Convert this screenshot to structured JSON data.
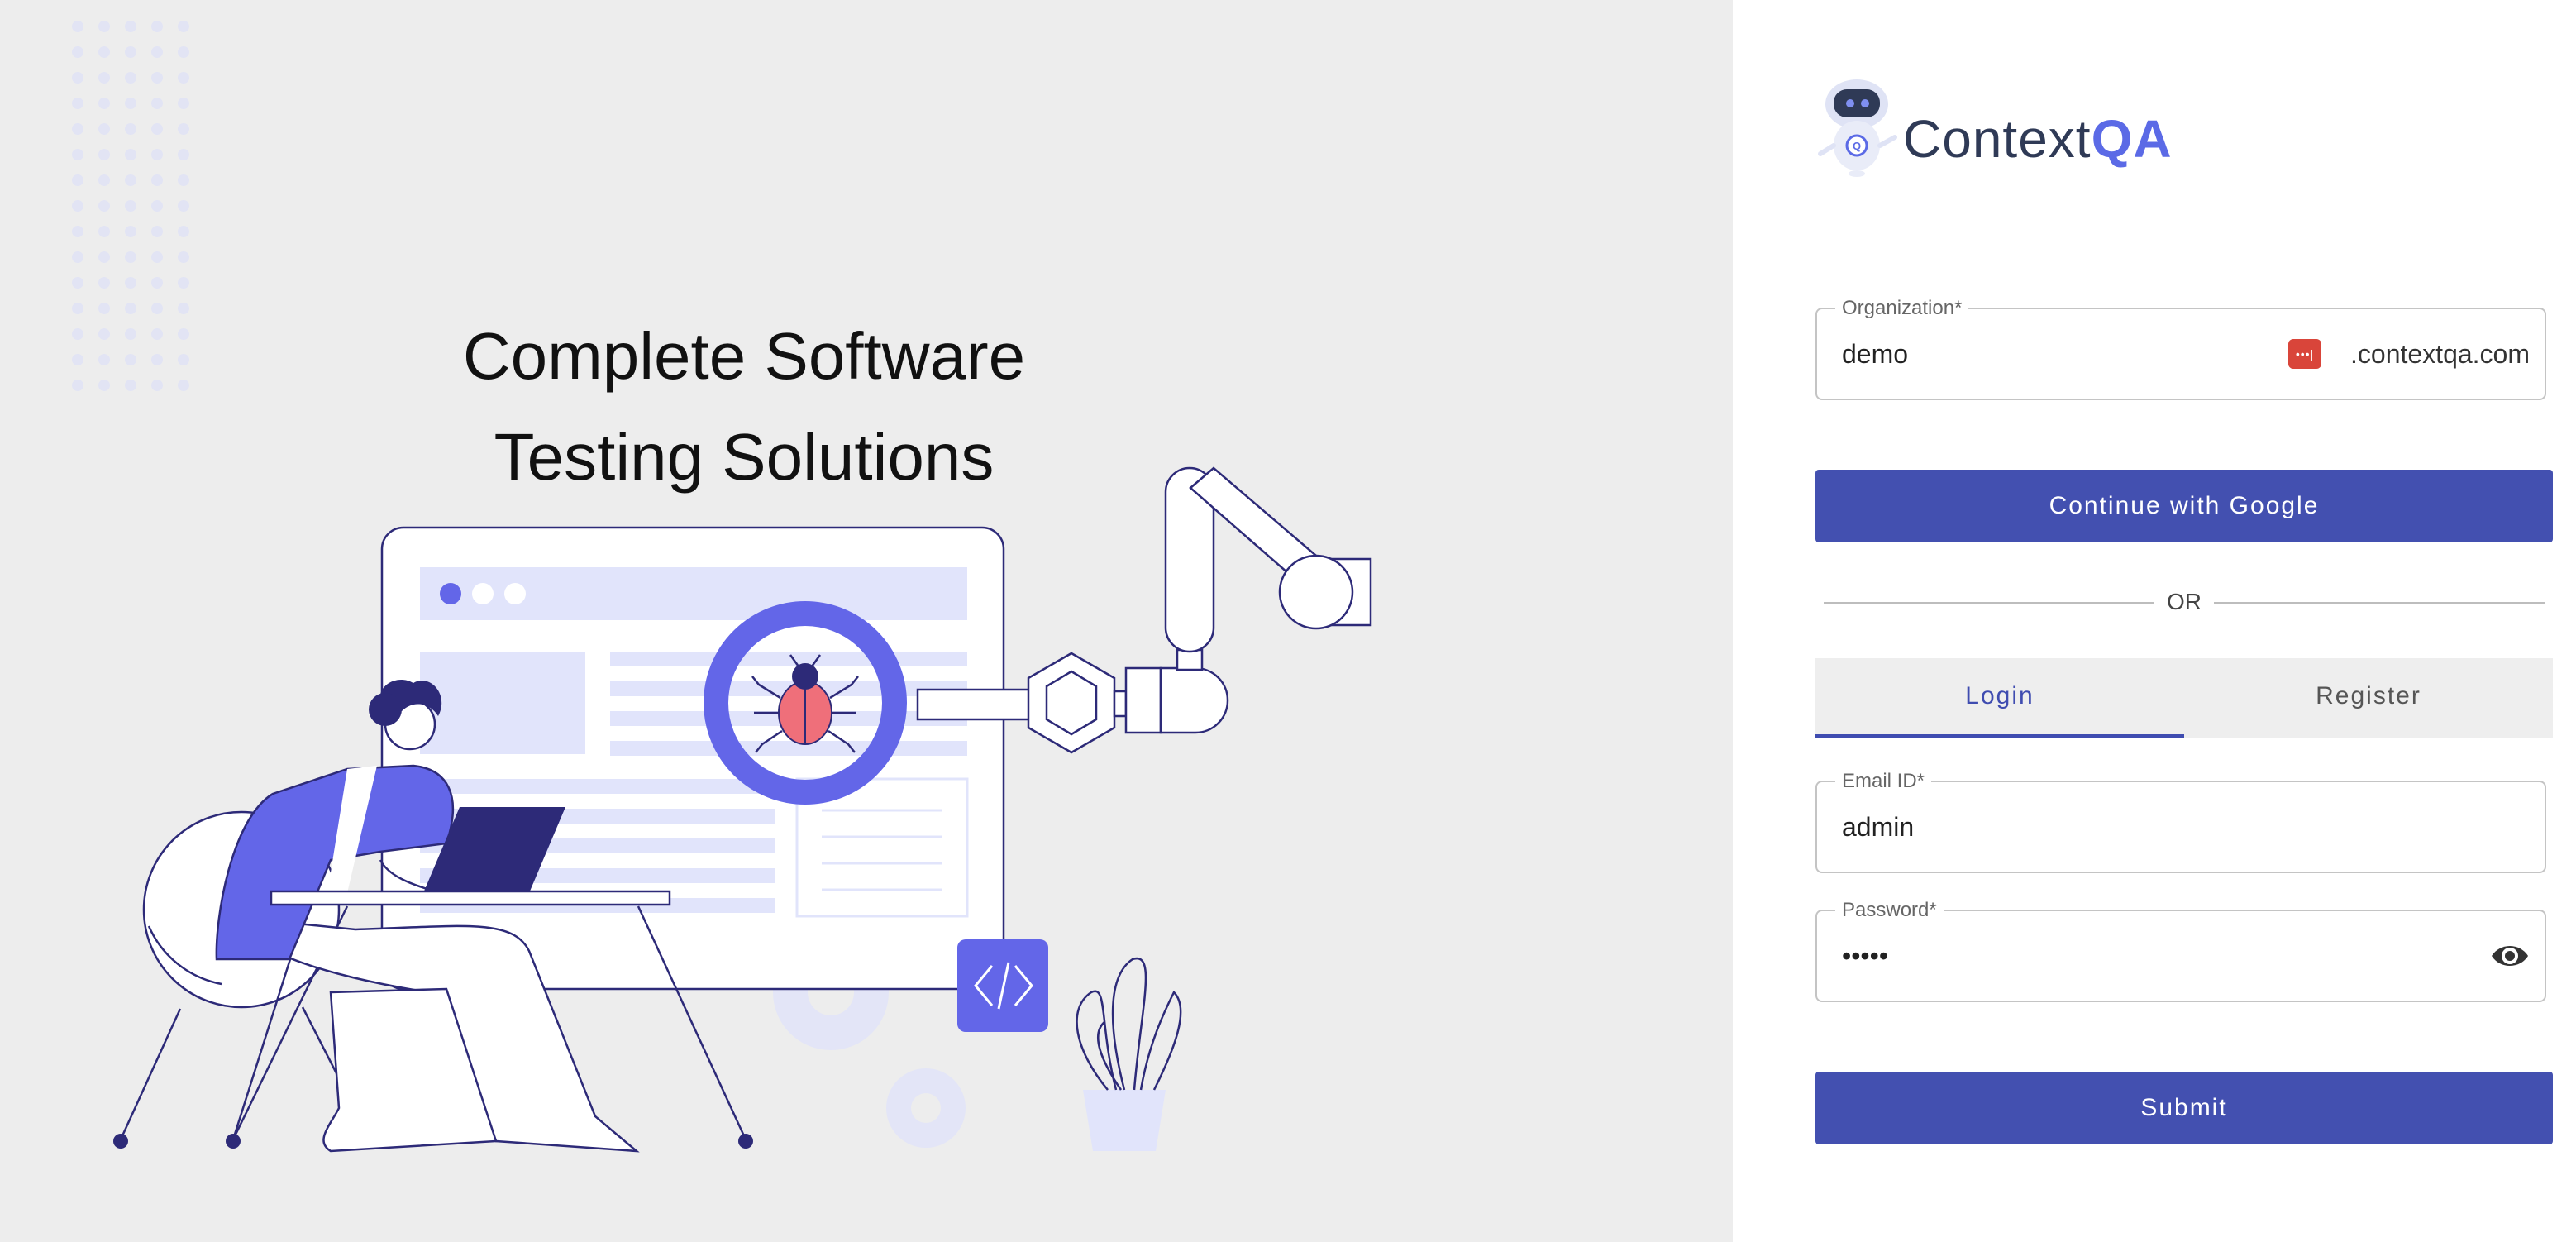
{
  "hero": {
    "headline_line1": "Complete Software",
    "headline_line2": "Testing Solutions"
  },
  "brand": {
    "name_part1": "Context",
    "name_part2": "QA",
    "text_color": "#2f3a56",
    "accent_color": "#5b6ae6"
  },
  "form": {
    "organization": {
      "label": "Organization*",
      "value": "demo",
      "suffix": ".contextqa.com",
      "badge_icon": "password-manager-icon"
    },
    "google_button_label": "Continue with Google",
    "divider_text": "OR",
    "tabs": [
      {
        "label": "Login",
        "active": true
      },
      {
        "label": "Register",
        "active": false
      }
    ],
    "email": {
      "label": "Email ID*",
      "value": "admin"
    },
    "password": {
      "label": "Password*",
      "value": "•••••",
      "toggle_icon": "eye-icon"
    },
    "submit_label": "Submit"
  },
  "colors": {
    "primary": "#4350b0",
    "left_background": "#ededed",
    "illustration_accent": "#6366e8",
    "illustration_outline": "#2d2a78",
    "bug": "#ef6f7a"
  }
}
